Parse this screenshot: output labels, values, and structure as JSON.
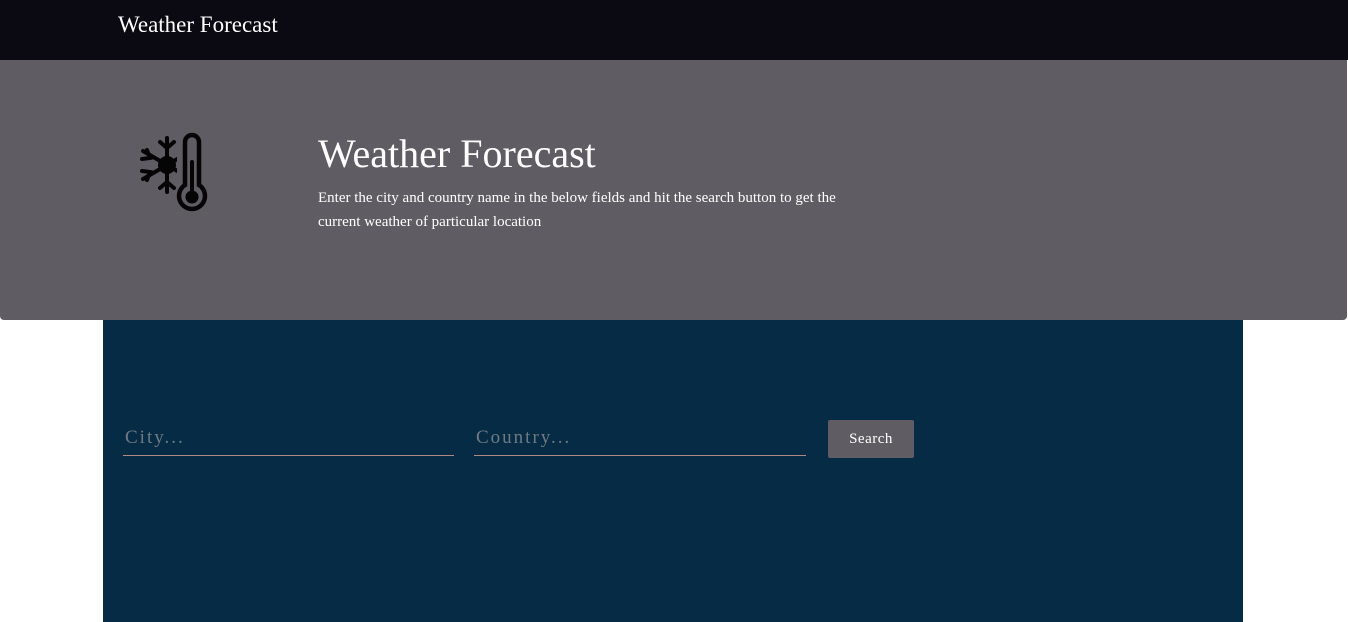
{
  "navbar": {
    "brand": "Weather Forecast"
  },
  "hero": {
    "icon": "snowflake-thermometer-icon",
    "title": "Weather Forecast",
    "description": "Enter the city and country name in the below fields and hit the search button to get the current weather of particular location"
  },
  "search": {
    "city_placeholder": "City...",
    "city_value": "",
    "country_placeholder": "Country...",
    "country_value": "",
    "button_label": "Search"
  },
  "colors": {
    "navbar_bg": "#0b0a12",
    "hero_bg": "#605c63",
    "panel_bg": "#062b44",
    "button_bg": "#605c63",
    "input_underline": "#b08a82"
  }
}
